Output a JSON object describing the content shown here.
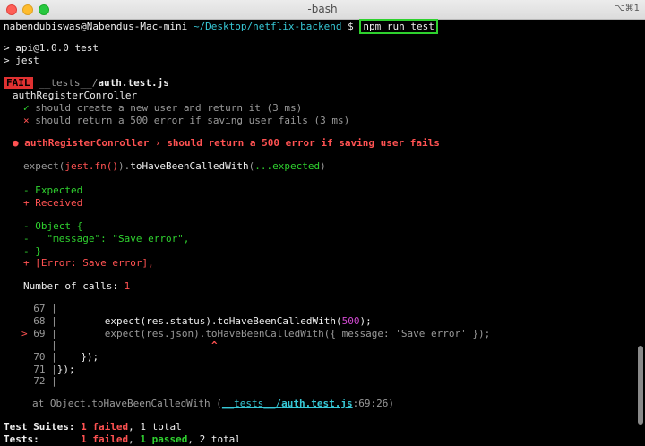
{
  "window": {
    "title": "-bash",
    "shortcut": "⌥⌘1"
  },
  "prompt": {
    "user_host": "nabendubiswas@Nabendus-Mac-mini",
    "path": "~/Desktop/netflix-backend",
    "symbol": "$",
    "command": "npm run test"
  },
  "npm_output": {
    "line1": "> api@1.0.0 test",
    "line2": "> jest"
  },
  "test_file": {
    "status": "FAIL",
    "dir": "__tests__/",
    "file": "auth.test.js",
    "suite": "authRegisterConroller",
    "tests": [
      {
        "mark": "✓",
        "name": "should create a new user and return it (3 ms)",
        "passed": true
      },
      {
        "mark": "×",
        "name": "should return a 500 error if saving user fails (3 ms)",
        "passed": false
      }
    ]
  },
  "failure": {
    "bullet": "●",
    "heading": "authRegisterConroller › should return a 500 error if saving user fails",
    "expect_prefix": "expect(",
    "expect_fn": "jest.fn()",
    "expect_close": ").",
    "expect_method": "toHaveBeenCalledWith",
    "expect_open": "(",
    "expect_args": "...expected",
    "expect_end": ")",
    "legend_expected": "- Expected",
    "legend_received": "+ Received",
    "diff": {
      "line1": "- Object {",
      "line2": "-   \"message\": \"Save error\",",
      "line3": "- }",
      "line4": "+ [Error: Save error],"
    },
    "calls_label": "Number of calls: ",
    "calls_value": "1"
  },
  "code_frame": {
    "lines": [
      {
        "marker": " ",
        "num": "67",
        "sep": "|",
        "code": ""
      },
      {
        "marker": " ",
        "num": "68",
        "sep": "|",
        "code": "        expect(res.status).toHaveBeenCalledWith(",
        "num_arg": "500",
        "code_end": ");"
      },
      {
        "marker": ">",
        "num": "69",
        "sep": "|",
        "code": "        expect(res.json).toHaveBeenCalledWith({ message: ",
        "str_arg": "'Save error'",
        "code_end": " });"
      },
      {
        "marker": " ",
        "num": "",
        "sep": "|",
        "code": "",
        "caret": "^"
      },
      {
        "marker": " ",
        "num": "70",
        "sep": "|",
        "code": "    });"
      },
      {
        "marker": " ",
        "num": "71",
        "sep": "|",
        "code": "});"
      },
      {
        "marker": " ",
        "num": "72",
        "sep": "|",
        "code": ""
      }
    ],
    "at_prefix": "at Object.toHaveBeenCalledWith (",
    "at_dir": "__tests__/",
    "at_file": "auth.test.js",
    "at_loc": ":69:26",
    "at_end": ")"
  },
  "summary": {
    "suites_label": "Test Suites:",
    "suites_failed": "1 failed",
    "suites_total": ", 1 total",
    "tests_label": "Tests:",
    "tests_failed": "1 failed",
    "tests_sep": ", ",
    "tests_passed": "1 passed",
    "tests_total": ", 2 total"
  },
  "colors": {
    "pass": "#2fd12f",
    "fail": "#ff5252",
    "path": "#37c8d6",
    "highlight_box": "#2ed12e"
  },
  "icons": {
    "pass": "checkmark-icon",
    "fail": "cross-icon",
    "error_bullet": "bullet-icon"
  }
}
